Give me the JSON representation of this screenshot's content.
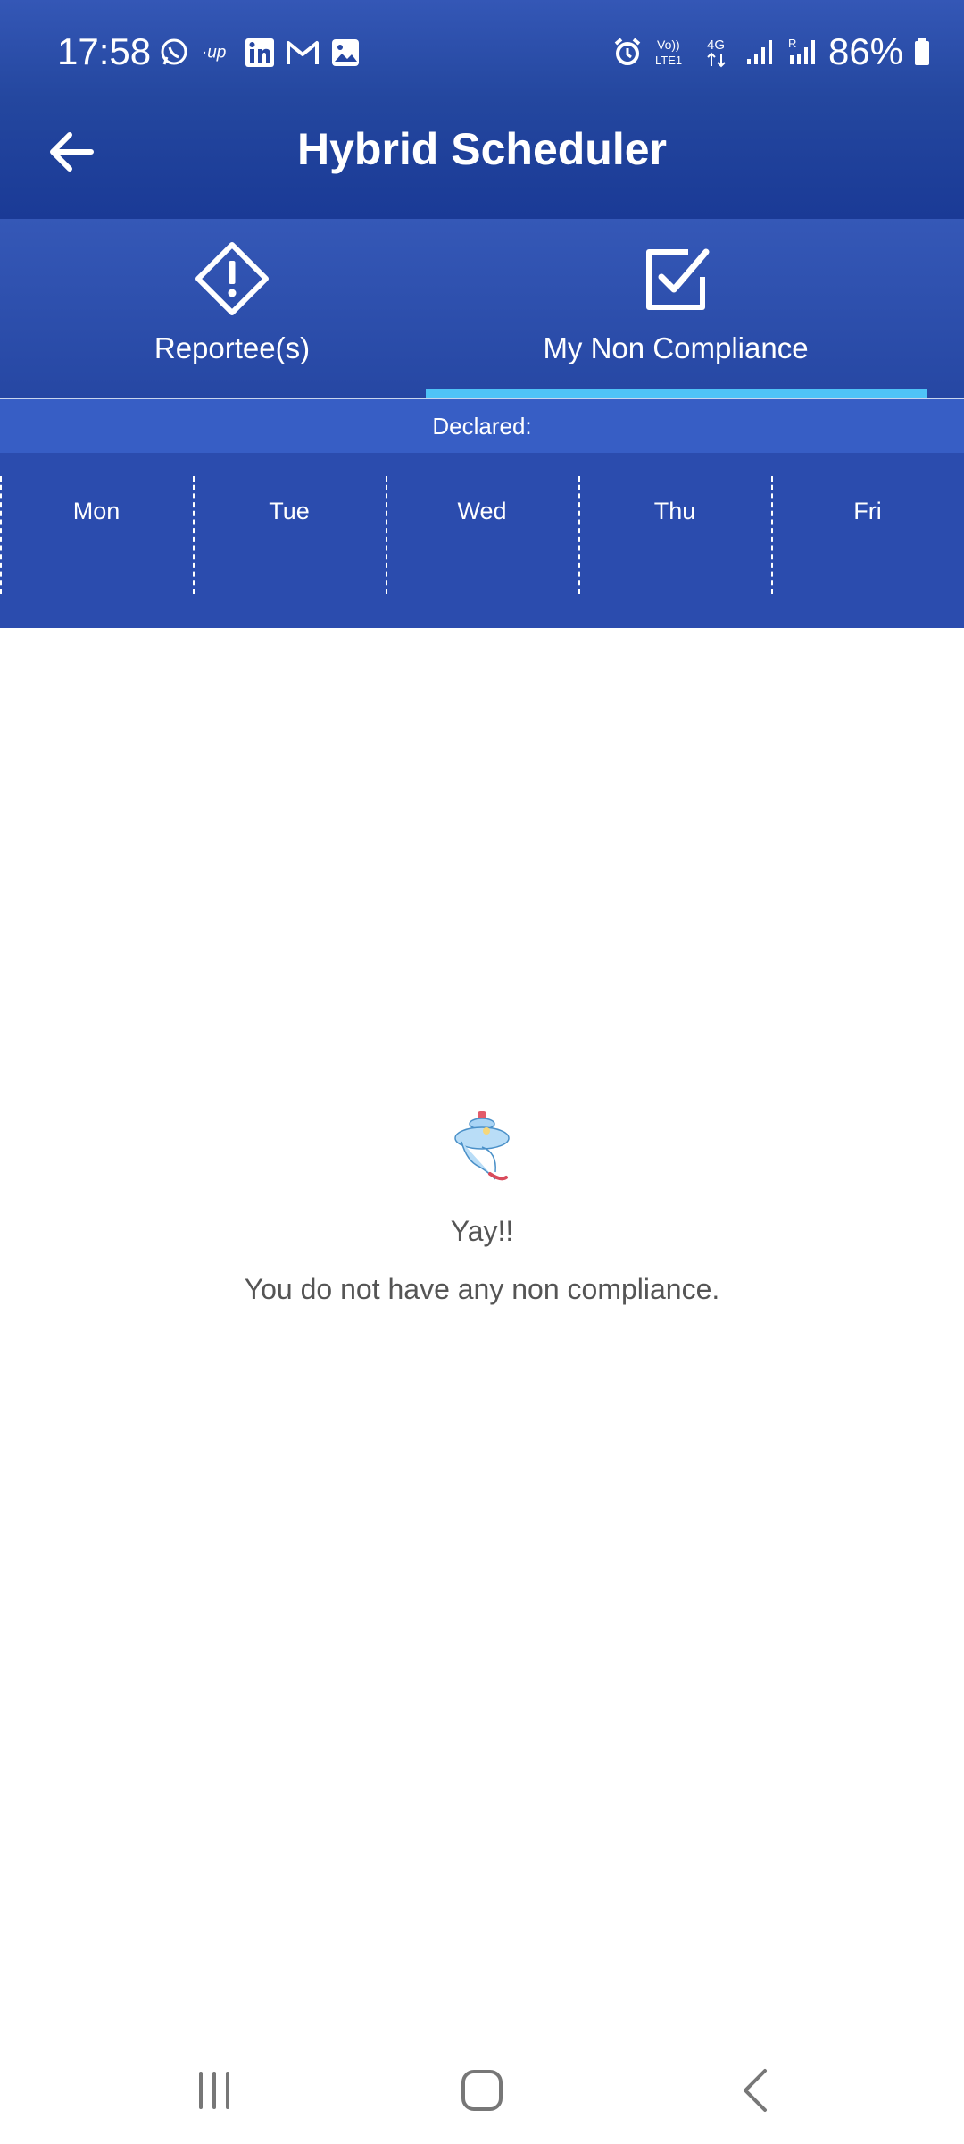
{
  "status_bar": {
    "time": "17:58",
    "battery": "86%",
    "left_icons": [
      "whatsapp-icon",
      "up-icon",
      "linkedin-icon",
      "gmail-icon",
      "gallery-icon"
    ],
    "right_icons": [
      "alarm-icon",
      "volte-icon",
      "4g-icon",
      "signal-icon",
      "signal-roaming-icon",
      "battery-icon"
    ]
  },
  "app_bar": {
    "title": "Hybrid Scheduler",
    "back_icon": "back-arrow-icon"
  },
  "tabs": [
    {
      "label": "Reportee(s)",
      "icon": "warning-diamond-icon",
      "selected": false
    },
    {
      "label": "My Non Compliance",
      "icon": "checkbox-icon",
      "selected": true
    }
  ],
  "declared": {
    "label": "Declared:"
  },
  "days": [
    "Mon",
    "Tue",
    "Wed",
    "Thu",
    "Fri"
  ],
  "empty_state": {
    "icon": "genie-icon",
    "title": "Yay!!",
    "message": "You do not have any non compliance."
  },
  "nav_bar": {
    "buttons": [
      "recents-icon",
      "home-icon",
      "back-icon"
    ]
  },
  "colors": {
    "header": "#24479f",
    "tab_indicator": "#4fc3f7",
    "declared_bar": "#375ec5",
    "days_panel": "#2b4cae",
    "text_gray": "#555555"
  }
}
